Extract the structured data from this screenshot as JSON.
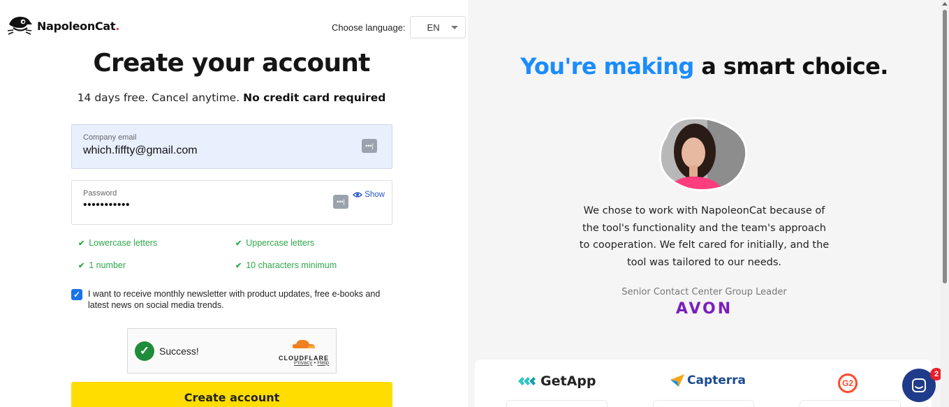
{
  "header": {
    "brand_name": "NapoleonCat",
    "brand_dot": ".",
    "language_label": "Choose language:",
    "language_value": "EN"
  },
  "form": {
    "title": "Create your account",
    "subtitle_plain": "14 days free. Cancel anytime.",
    "subtitle_bold": "No credit card required",
    "email_label": "Company email",
    "email_value": "which.fiffty@gmail.com",
    "password_label": "Password",
    "password_value": "•••••••••••",
    "show_label": "Show",
    "rules": [
      {
        "label": "Lowercase letters"
      },
      {
        "label": "Uppercase letters"
      },
      {
        "label": "1 number"
      },
      {
        "label": "10 characters minimum"
      }
    ],
    "newsletter_text": "I want to receive monthly newsletter with product updates, free e-books and latest news on social media trends.",
    "newsletter_checked": true,
    "captcha": {
      "status": "Success!",
      "provider": "CLOUDFLARE",
      "privacy": "Privacy",
      "separator": "•",
      "help": "Help"
    },
    "submit_label": "Create account"
  },
  "promo": {
    "headline_highlight": "You're making",
    "headline_rest": " a smart choice.",
    "quote": "We chose to work with NapoleonCat because of the tool's functionality and the team's approach to cooperation. We felt cared for initially, and the tool was tailored to our needs.",
    "role": "Senior Contact Center Group Leader",
    "company": "AVON",
    "reviews": {
      "getapp": "GetApp",
      "capterra": "Capterra",
      "g2": "G2"
    }
  },
  "chat": {
    "badge_count": "2"
  },
  "colors": {
    "accent_blue": "#1a8cff",
    "cta_yellow": "#ffdd00",
    "success_green": "#2ea84a",
    "avon_purple": "#7a1fbf"
  }
}
